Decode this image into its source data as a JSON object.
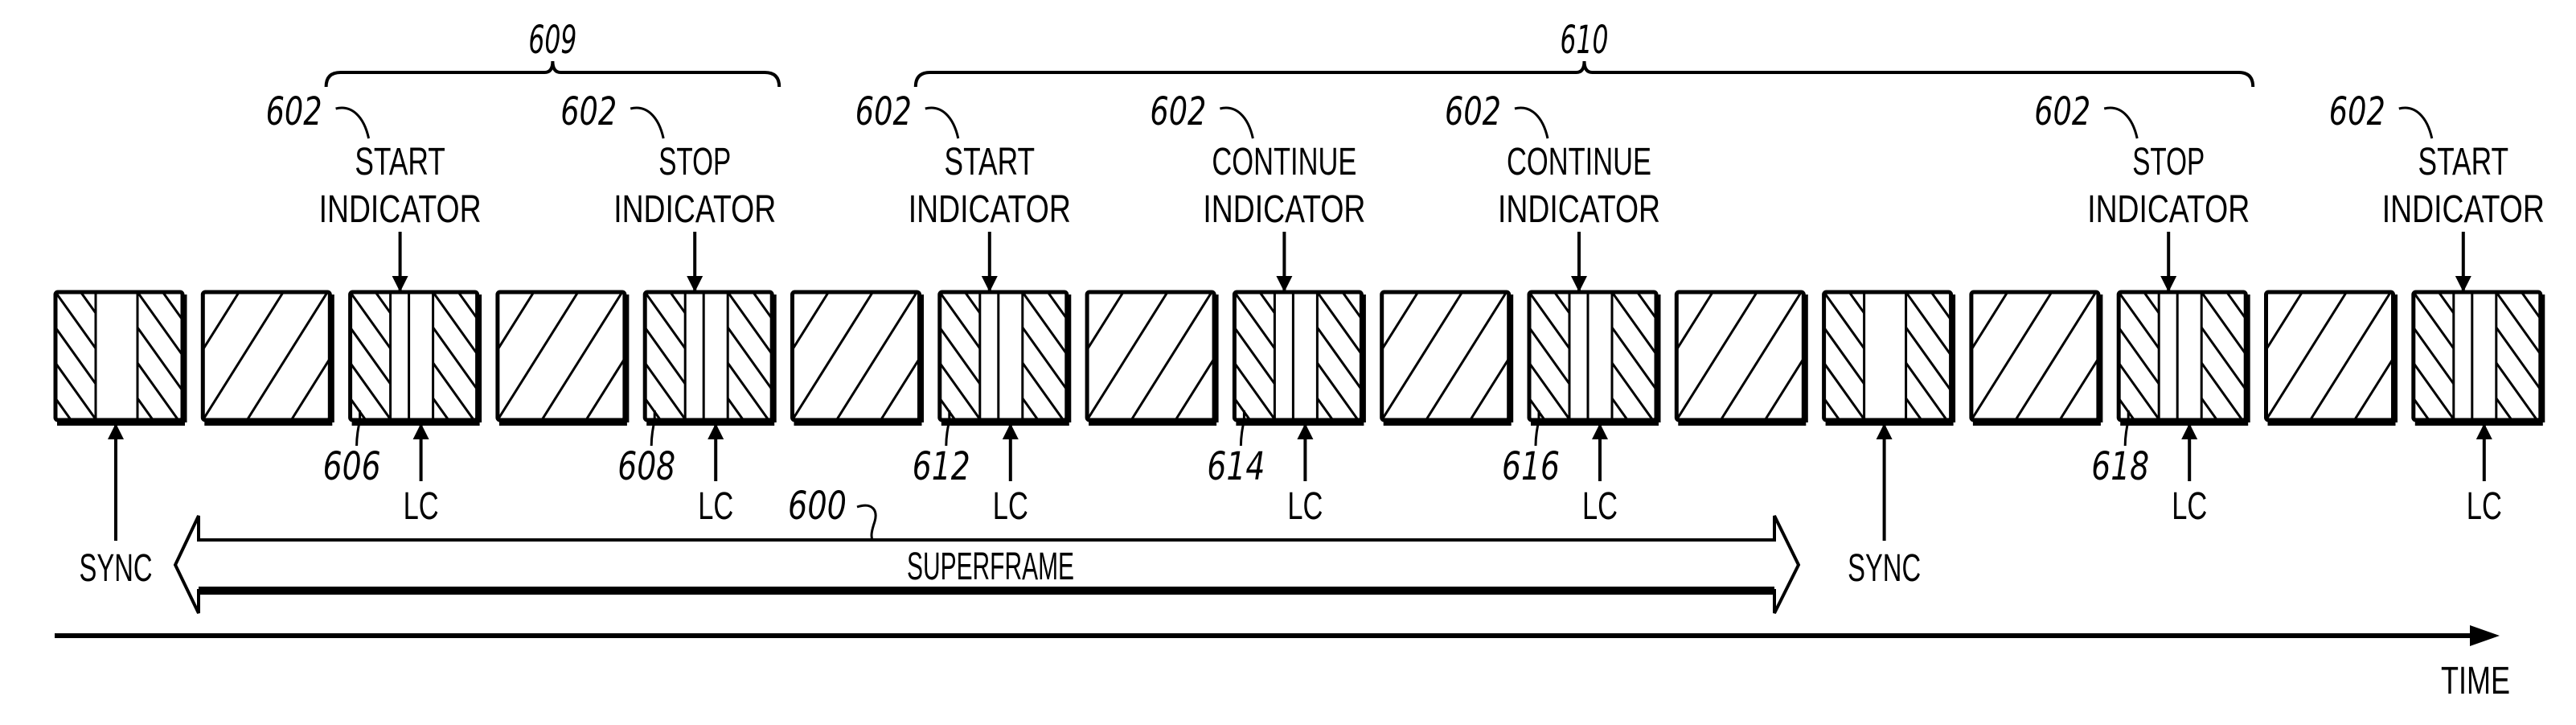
{
  "figure": {
    "colors": {
      "ink": "#000000",
      "paper": "#ffffff"
    },
    "blocks": [
      {
        "type": "sync"
      },
      {
        "type": "hatch"
      },
      {
        "type": "control",
        "ref": "606",
        "lc": "LC"
      },
      {
        "type": "hatch"
      },
      {
        "type": "control",
        "ref": "608",
        "lc": "LC"
      },
      {
        "type": "hatch"
      },
      {
        "type": "control",
        "ref": "612",
        "lc": "LC"
      },
      {
        "type": "hatch"
      },
      {
        "type": "control",
        "ref": "614",
        "lc": "LC"
      },
      {
        "type": "hatch"
      },
      {
        "type": "control",
        "ref": "616",
        "lc": "LC"
      },
      {
        "type": "hatch"
      },
      {
        "type": "sync"
      },
      {
        "type": "hatch"
      },
      {
        "type": "control",
        "ref": "618",
        "lc": "LC"
      },
      {
        "type": "hatch"
      },
      {
        "type": "control",
        "ref": "",
        "lc": "LC"
      }
    ],
    "indicators": [
      {
        "block": 2,
        "ref": "602",
        "line1": "START",
        "line2": "INDICATOR"
      },
      {
        "block": 4,
        "ref": "602",
        "line1": "STOP",
        "line2": "INDICATOR"
      },
      {
        "block": 6,
        "ref": "602",
        "line1": "START",
        "line2": "INDICATOR"
      },
      {
        "block": 8,
        "ref": "602",
        "line1": "CONTINUE",
        "line2": "INDICATOR"
      },
      {
        "block": 10,
        "ref": "602",
        "line1": "CONTINUE",
        "line2": "INDICATOR"
      },
      {
        "block": 14,
        "ref": "602",
        "line1": "STOP",
        "line2": "INDICATOR"
      },
      {
        "block": 16,
        "ref": "602",
        "line1": "START",
        "line2": "INDICATOR"
      }
    ],
    "groups": [
      {
        "ref": "609",
        "from_indicator": 0,
        "to_indicator": 1
      },
      {
        "ref": "610",
        "from_indicator": 2,
        "to_indicator": 5
      }
    ],
    "sync_labels": [
      {
        "block": 0,
        "text": "SYNC"
      },
      {
        "block": 12,
        "text": "SYNC"
      }
    ],
    "superframe": {
      "ref": "600",
      "label": "SUPERFRAME"
    },
    "time_axis": {
      "label": "TIME"
    }
  }
}
